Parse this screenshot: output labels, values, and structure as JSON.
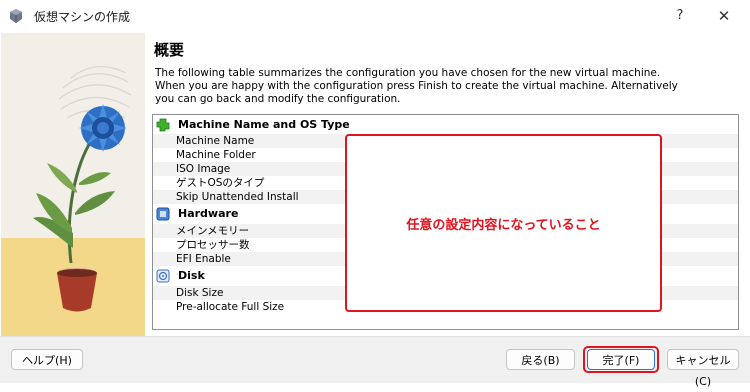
{
  "window": {
    "title": "仮想マシンの作成",
    "help_glyph": "?",
    "close_glyph": "✕"
  },
  "page": {
    "heading": "概要",
    "description": [
      "The following table summarizes the configuration you have chosen for the new virtual machine.",
      "When you are happy with the configuration press Finish to create the virtual machine. Alternatively",
      "you can go back and modify the configuration."
    ]
  },
  "summary": {
    "sections": [
      {
        "title": "Machine Name and OS Type",
        "icon": "puzzle-icon",
        "items": [
          "Machine Name",
          "Machine Folder",
          "ISO Image",
          "ゲストOSのタイプ",
          "Skip Unattended Install"
        ]
      },
      {
        "title": "Hardware",
        "icon": "chip-icon",
        "items": [
          "メインメモリー",
          "プロセッサー数",
          "EFI Enable"
        ]
      },
      {
        "title": "Disk",
        "icon": "disk-icon",
        "items": [
          "Disk Size",
          "Pre-allocate Full Size"
        ]
      }
    ]
  },
  "annotation": {
    "text": "任意の設定内容になっていること",
    "color": "#e0141e"
  },
  "buttons": {
    "help": "ヘルプ(H)",
    "back": "戻る(B)",
    "finish": "完了(F)",
    "cancel": "キャンセル(C)"
  }
}
